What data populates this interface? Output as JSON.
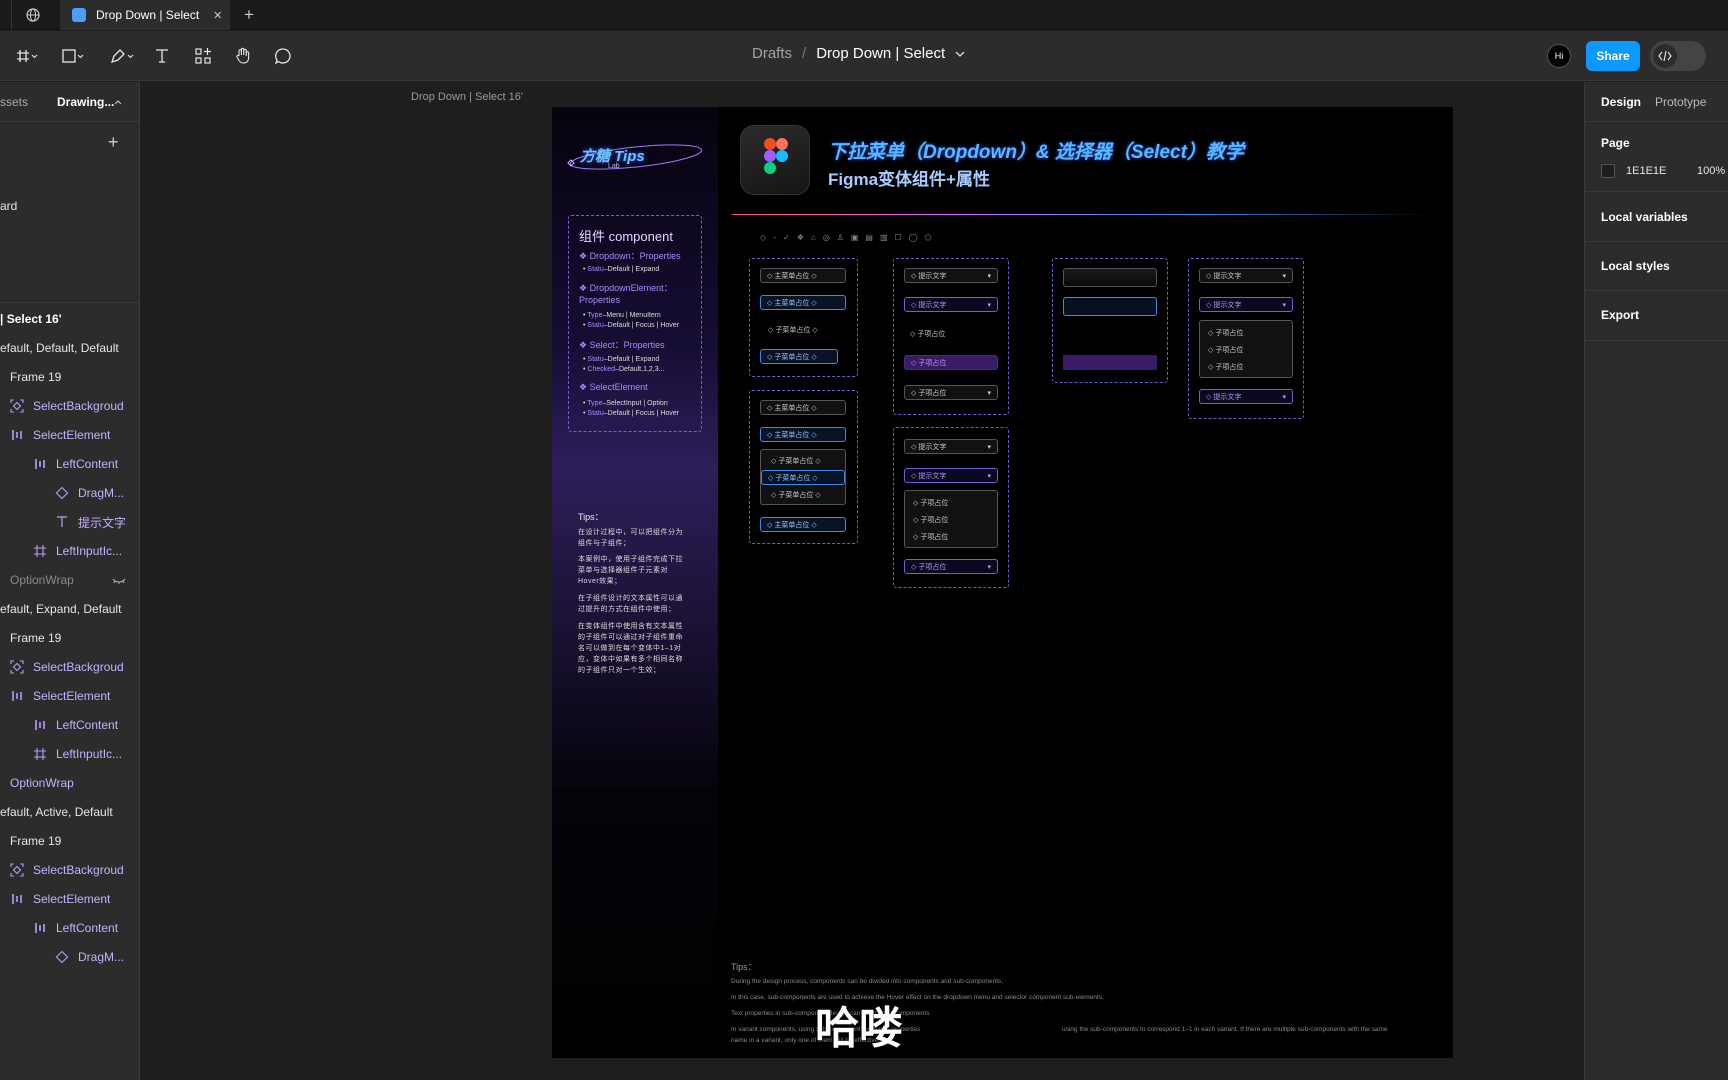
{
  "tabs": {
    "active": "Drop Down | Select",
    "close": "✕",
    "new": "+"
  },
  "toolbar": {
    "breadcrumb_root": "Drafts",
    "separator": "/",
    "file_name": "Drop Down | Select",
    "avatar": "Hi",
    "share": "Share"
  },
  "left_panel": {
    "tab_assets": "ssets",
    "tab_drawing": "Drawing...",
    "add": "+",
    "page_label": "ard",
    "frame_label": "| Select 16'",
    "layers": [
      {
        "label": "efault, Default, Default",
        "indent": 0,
        "icon": "",
        "color": "#e6e6e6"
      },
      {
        "label": "Frame 19",
        "indent": 1,
        "icon": "",
        "color": "#e6e6e6"
      },
      {
        "label": "SelectBackgroud",
        "indent": 1,
        "icon": "instance",
        "color": "#c6b0ff"
      },
      {
        "label": "SelectElement",
        "indent": 1,
        "icon": "autolayout",
        "color": "#c6b0ff"
      },
      {
        "label": "LeftContent",
        "indent": 2,
        "icon": "autolayout",
        "color": "#c6b0ff"
      },
      {
        "label": "DragM...",
        "indent": 3,
        "icon": "diamond",
        "color": "#c6b0ff"
      },
      {
        "label": "提示文字",
        "indent": 3,
        "icon": "text",
        "color": "#c6b0ff"
      },
      {
        "label": "LeftInputIc...",
        "indent": 2,
        "icon": "frame",
        "color": "#c6b0ff"
      },
      {
        "label": "OptionWrap",
        "indent": 1,
        "icon": "",
        "color": "#8a8a8a"
      },
      {
        "label": "efault, Expand, Default",
        "indent": 0,
        "icon": "",
        "color": "#e6e6e6"
      },
      {
        "label": "Frame 19",
        "indent": 1,
        "icon": "",
        "color": "#e6e6e6"
      },
      {
        "label": "SelectBackgroud",
        "indent": 1,
        "icon": "instance",
        "color": "#c6b0ff"
      },
      {
        "label": "SelectElement",
        "indent": 1,
        "icon": "autolayout",
        "color": "#c6b0ff"
      },
      {
        "label": "LeftContent",
        "indent": 2,
        "icon": "autolayout",
        "color": "#c6b0ff"
      },
      {
        "label": "LeftInputIc...",
        "indent": 2,
        "icon": "frame",
        "color": "#c6b0ff"
      },
      {
        "label": "OptionWrap",
        "indent": 1,
        "icon": "",
        "color": "#c6b0ff"
      },
      {
        "label": "efault, Active, Default",
        "indent": 0,
        "icon": "",
        "color": "#e6e6e6"
      },
      {
        "label": "Frame 19",
        "indent": 1,
        "icon": "",
        "color": "#e6e6e6"
      },
      {
        "label": "SelectBackgroud",
        "indent": 1,
        "icon": "instance",
        "color": "#c6b0ff"
      },
      {
        "label": "SelectElement",
        "indent": 1,
        "icon": "autolayout",
        "color": "#c6b0ff"
      },
      {
        "label": "LeftContent",
        "indent": 2,
        "icon": "autolayout",
        "color": "#c6b0ff"
      },
      {
        "label": "DragM...",
        "indent": 3,
        "icon": "diamond",
        "color": "#c6b0ff"
      }
    ]
  },
  "right_panel": {
    "tab_design": "Design",
    "tab_prototype": "Prototype",
    "page": "Page",
    "page_color": "1E1E1E",
    "page_opacity": "100%",
    "local_variables": "Local variables",
    "local_styles": "Local styles",
    "export": "Export"
  },
  "canvas": {
    "frame_label": "Drop Down | Select  16'",
    "logo_text": "方糖 Tips",
    "logo_sub": "Lab",
    "title_main": "下拉菜单（Dropdown）& 选择器（Select）教学",
    "title_sub": "Figma变体组件+属性",
    "comp_box": {
      "title": "组件 component",
      "dropdown_props": "Dropdown：Properties",
      "dropdown_status_key": "Statu",
      "dropdown_status_val": "–Default | Expand",
      "element_props": "DropdownElement：Properties",
      "element_type_key": "Type",
      "element_type_val": "–Menu | MenuItem",
      "element_status_key": "Statu",
      "element_status_val": "–Default | Focus | Hover",
      "select_props": "Select：Properties",
      "select_status_key": "Statu",
      "select_status_val": "–Default | Expand",
      "select_checked_key": "Checked",
      "select_checked_val": "–Default,1,2,3...",
      "selelem_props": "SelectElement",
      "selelem_type_key": "Type",
      "selelem_type_val": "–SelectInput | Option",
      "selelem_status_key": "Statu",
      "selelem_status_val": "–Default | Focus | Hover"
    },
    "tips_cn": {
      "title": "Tips：",
      "p1": "在设计过程中，可以把组件分为组件与子组件；",
      "p2": "本案例中，使用子组件完成下拉菜单与选择器组件子元素对Hover效果；",
      "p3": "在子组件设计的文本属性可以通过提升的方式在组件中使用；",
      "p4": "在变体组件中使用含有文本属性的子组件可以通过对子组件重命名可以做到在每个变体中1–1对应，变体中如果有多个相同名称的子组件只对一个生效；"
    },
    "labels": {
      "menu": "主菜单占位",
      "sub": "子菜单占位",
      "hint": "提示文字",
      "item": "子项占位"
    },
    "tips_en": {
      "title": "Tips：",
      "l1": "During the design process, components can be divided into components and sub-components;",
      "l2": "In this case, sub-components are used to achieve the Hover effect on the dropdown menu and selector component sub-elements;",
      "l3": "Text properties in sub-component design can be used in components",
      "l4a": "In variant components, using sub-components with text properties",
      "l4b": "using the sub-components to correspond 1–1 in each variant. If there are multiple sub-components with the same",
      "l5": "name in a variant, only one of them will be effective."
    },
    "caption": "哈喽"
  },
  "colors": {
    "accent_blue": "#3d8ae8",
    "accent_purple": "#8b6cf2",
    "panel": "#2c2c2c",
    "canvas": "#1e1e1e"
  }
}
